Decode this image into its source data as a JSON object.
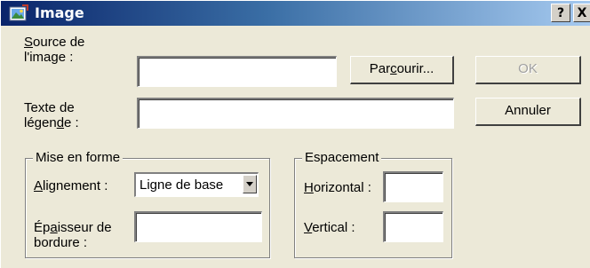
{
  "window": {
    "title": "Image",
    "help_label": "?",
    "close_label": "X",
    "icon": "image-app-icon"
  },
  "source": {
    "label_line1": "Source de",
    "label_line2": "l'image :",
    "value": "",
    "browse_label": "Parcourir..."
  },
  "caption": {
    "label_line1": "Texte de",
    "label_line2": "légende :",
    "value": ""
  },
  "buttons": {
    "ok_label": "OK",
    "cancel_label": "Annuler"
  },
  "formatting": {
    "legend": "Mise en forme",
    "alignment_label": "Alignement :",
    "alignment_value": "Ligne de base",
    "border_label_line1": "Épaisseur de",
    "border_label_line2": "bordure :",
    "border_value": ""
  },
  "spacing": {
    "legend": "Espacement",
    "horizontal_label": "Horizontal :",
    "horizontal_value": "",
    "vertical_label": "Vertical :",
    "vertical_value": ""
  },
  "colors": {
    "titlebar_start": "#0a246a",
    "titlebar_end": "#a6caf0",
    "dialog_bg": "#ece9d8"
  }
}
